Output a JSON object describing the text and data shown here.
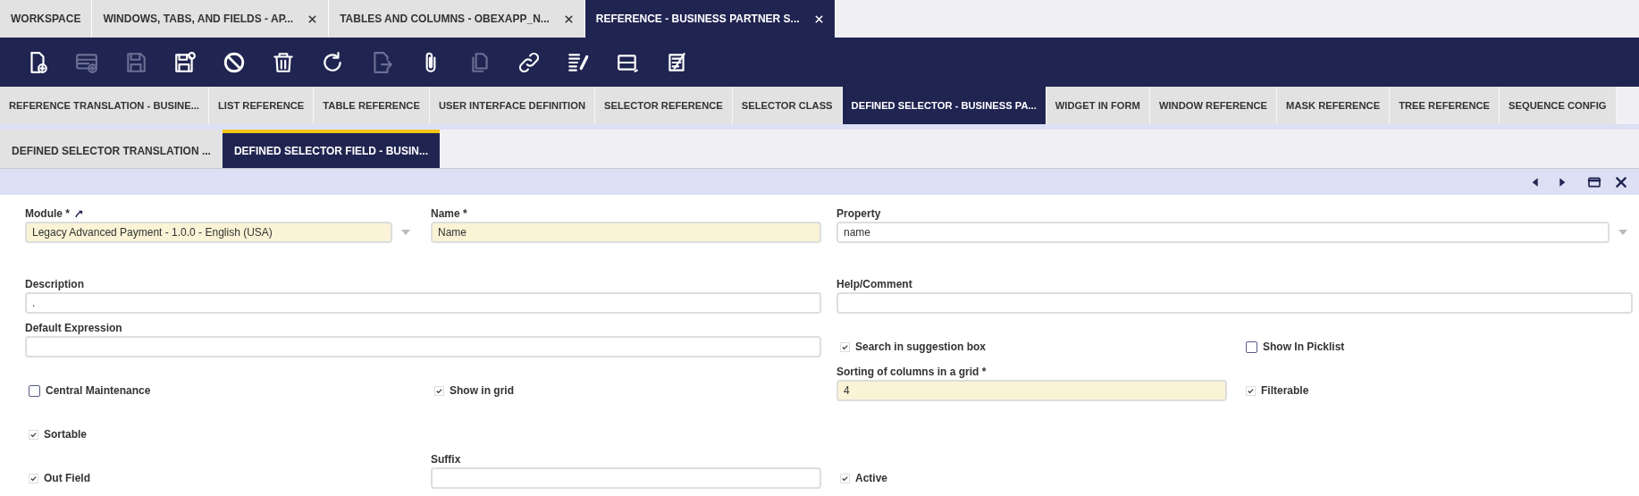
{
  "window_tabs": [
    {
      "label": "WORKSPACE",
      "closable": false,
      "selected": false
    },
    {
      "label": "WINDOWS, TABS, AND FIELDS - AP...",
      "closable": true,
      "selected": false
    },
    {
      "label": "TABLES AND COLUMNS - OBEXAPP_N...",
      "closable": true,
      "selected": false
    },
    {
      "label": "REFERENCE - BUSINESS PARTNER S...",
      "closable": true,
      "selected": true
    }
  ],
  "toolbar": [
    {
      "kind": "new-document",
      "disabled": false
    },
    {
      "kind": "new-row",
      "disabled": true
    },
    {
      "kind": "save",
      "disabled": true
    },
    {
      "kind": "save-close",
      "disabled": false
    },
    {
      "kind": "cancel",
      "disabled": false
    },
    {
      "kind": "delete",
      "disabled": false
    },
    {
      "kind": "refresh",
      "disabled": false
    },
    {
      "kind": "export",
      "disabled": true
    },
    {
      "kind": "attach",
      "disabled": false
    },
    {
      "kind": "clone",
      "disabled": true
    },
    {
      "kind": "link",
      "disabled": false
    },
    {
      "kind": "audit",
      "disabled": false
    },
    {
      "kind": "grid",
      "disabled": false
    },
    {
      "kind": "notes",
      "disabled": false
    }
  ],
  "tabs": [
    {
      "label": "REFERENCE TRANSLATION - BUSINE...",
      "selected": false
    },
    {
      "label": "LIST REFERENCE",
      "selected": false
    },
    {
      "label": "TABLE REFERENCE",
      "selected": false
    },
    {
      "label": "USER INTERFACE DEFINITION",
      "selected": false
    },
    {
      "label": "SELECTOR REFERENCE",
      "selected": false
    },
    {
      "label": "SELECTOR CLASS",
      "selected": false
    },
    {
      "label": "DEFINED SELECTOR - BUSINESS PA...",
      "selected": true
    },
    {
      "label": "WIDGET IN FORM",
      "selected": false
    },
    {
      "label": "WINDOW REFERENCE",
      "selected": false
    },
    {
      "label": "MASK REFERENCE",
      "selected": false
    },
    {
      "label": "TREE REFERENCE",
      "selected": false
    },
    {
      "label": "SEQUENCE CONFIG",
      "selected": false
    }
  ],
  "subtabs": [
    {
      "label": "DEFINED SELECTOR TRANSLATION ...",
      "selected": false
    },
    {
      "label": "DEFINED SELECTOR FIELD - BUSIN...",
      "selected": true
    }
  ],
  "record_nav": [
    {
      "kind": "previous"
    },
    {
      "kind": "next"
    },
    {
      "kind": "maximize"
    },
    {
      "kind": "close"
    }
  ],
  "form": {
    "rows": [
      [
        {
          "kind": "combo",
          "label": "Module *",
          "link": true,
          "value": "Legacy Advanced Payment - 1.0.0 - English (USA)",
          "required": true
        },
        {
          "kind": "text",
          "label": "Name *",
          "value": "Name",
          "required": true
        },
        {
          "kind": "combo",
          "colspan": 2,
          "label": "Property",
          "value": "name",
          "required": false
        }
      ],
      [
        {
          "kind": "text",
          "colspan": 2,
          "label": "Description",
          "value": ".",
          "required": false
        },
        {
          "kind": "text",
          "colspan": 2,
          "label": "Help/Comment",
          "required": false
        }
      ],
      [
        {
          "kind": "text",
          "colspan": 2,
          "label": "Default Expression",
          "required": false
        },
        {
          "kind": "checkbox",
          "label": "Search in suggestion box",
          "checked": true
        },
        {
          "kind": "checkbox",
          "label": "Show In Picklist",
          "checked": false
        }
      ],
      [
        {
          "kind": "checkbox",
          "label": "Central Maintenance",
          "checked": false
        },
        {
          "kind": "checkbox",
          "label": "Show in grid",
          "checked": true
        },
        {
          "kind": "text",
          "label": "Sorting of columns in a grid *",
          "value": "4",
          "required": true
        },
        {
          "kind": "checkbox",
          "label": "Filterable",
          "checked": true
        }
      ],
      [
        {
          "kind": "checkbox",
          "label": "Sortable",
          "checked": true
        }
      ],
      [
        {
          "kind": "checkbox",
          "label": "Out Field",
          "checked": true
        },
        {
          "kind": "text",
          "label": "Suffix",
          "required": false
        },
        {
          "kind": "checkbox",
          "label": "Active",
          "checked": true
        }
      ]
    ]
  }
}
